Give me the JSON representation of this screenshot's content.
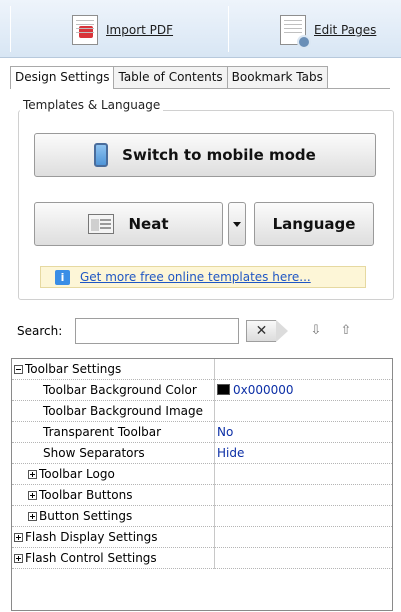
{
  "toolbar": {
    "import_pdf": "Import PDF",
    "edit_pages": "Edit Pages"
  },
  "tabs": [
    {
      "label": "Design Settings",
      "active": true
    },
    {
      "label": "Table of Contents",
      "active": false
    },
    {
      "label": "Bookmark Tabs",
      "active": false
    }
  ],
  "templates": {
    "group_title": "Templates & Language",
    "switch_mobile": "Switch to mobile mode",
    "template_name": "Neat",
    "language": "Language",
    "more_templates_link": "Get more free online templates here..."
  },
  "search": {
    "label": "Search:",
    "value": ""
  },
  "properties": [
    {
      "name": "Toolbar Settings",
      "value": "",
      "expander": "minus",
      "level": 0
    },
    {
      "name": "Toolbar Background Color",
      "value": "0x000000",
      "swatch": "#000000",
      "level": 2
    },
    {
      "name": "Toolbar Background Image",
      "value": "",
      "level": 2
    },
    {
      "name": "Transparent Toolbar",
      "value": "No",
      "level": 2
    },
    {
      "name": "Show Separators",
      "value": "Hide",
      "level": 2
    },
    {
      "name": "Toolbar Logo",
      "value": "",
      "expander": "plus",
      "level": 1
    },
    {
      "name": "Toolbar Buttons",
      "value": "",
      "expander": "plus",
      "level": 1
    },
    {
      "name": "Button Settings",
      "value": "",
      "expander": "plus",
      "level": 1
    },
    {
      "name": "Flash Display Settings",
      "value": "",
      "expander": "plus",
      "level": 0
    },
    {
      "name": "Flash Control Settings",
      "value": "",
      "expander": "plus",
      "level": 0
    }
  ]
}
